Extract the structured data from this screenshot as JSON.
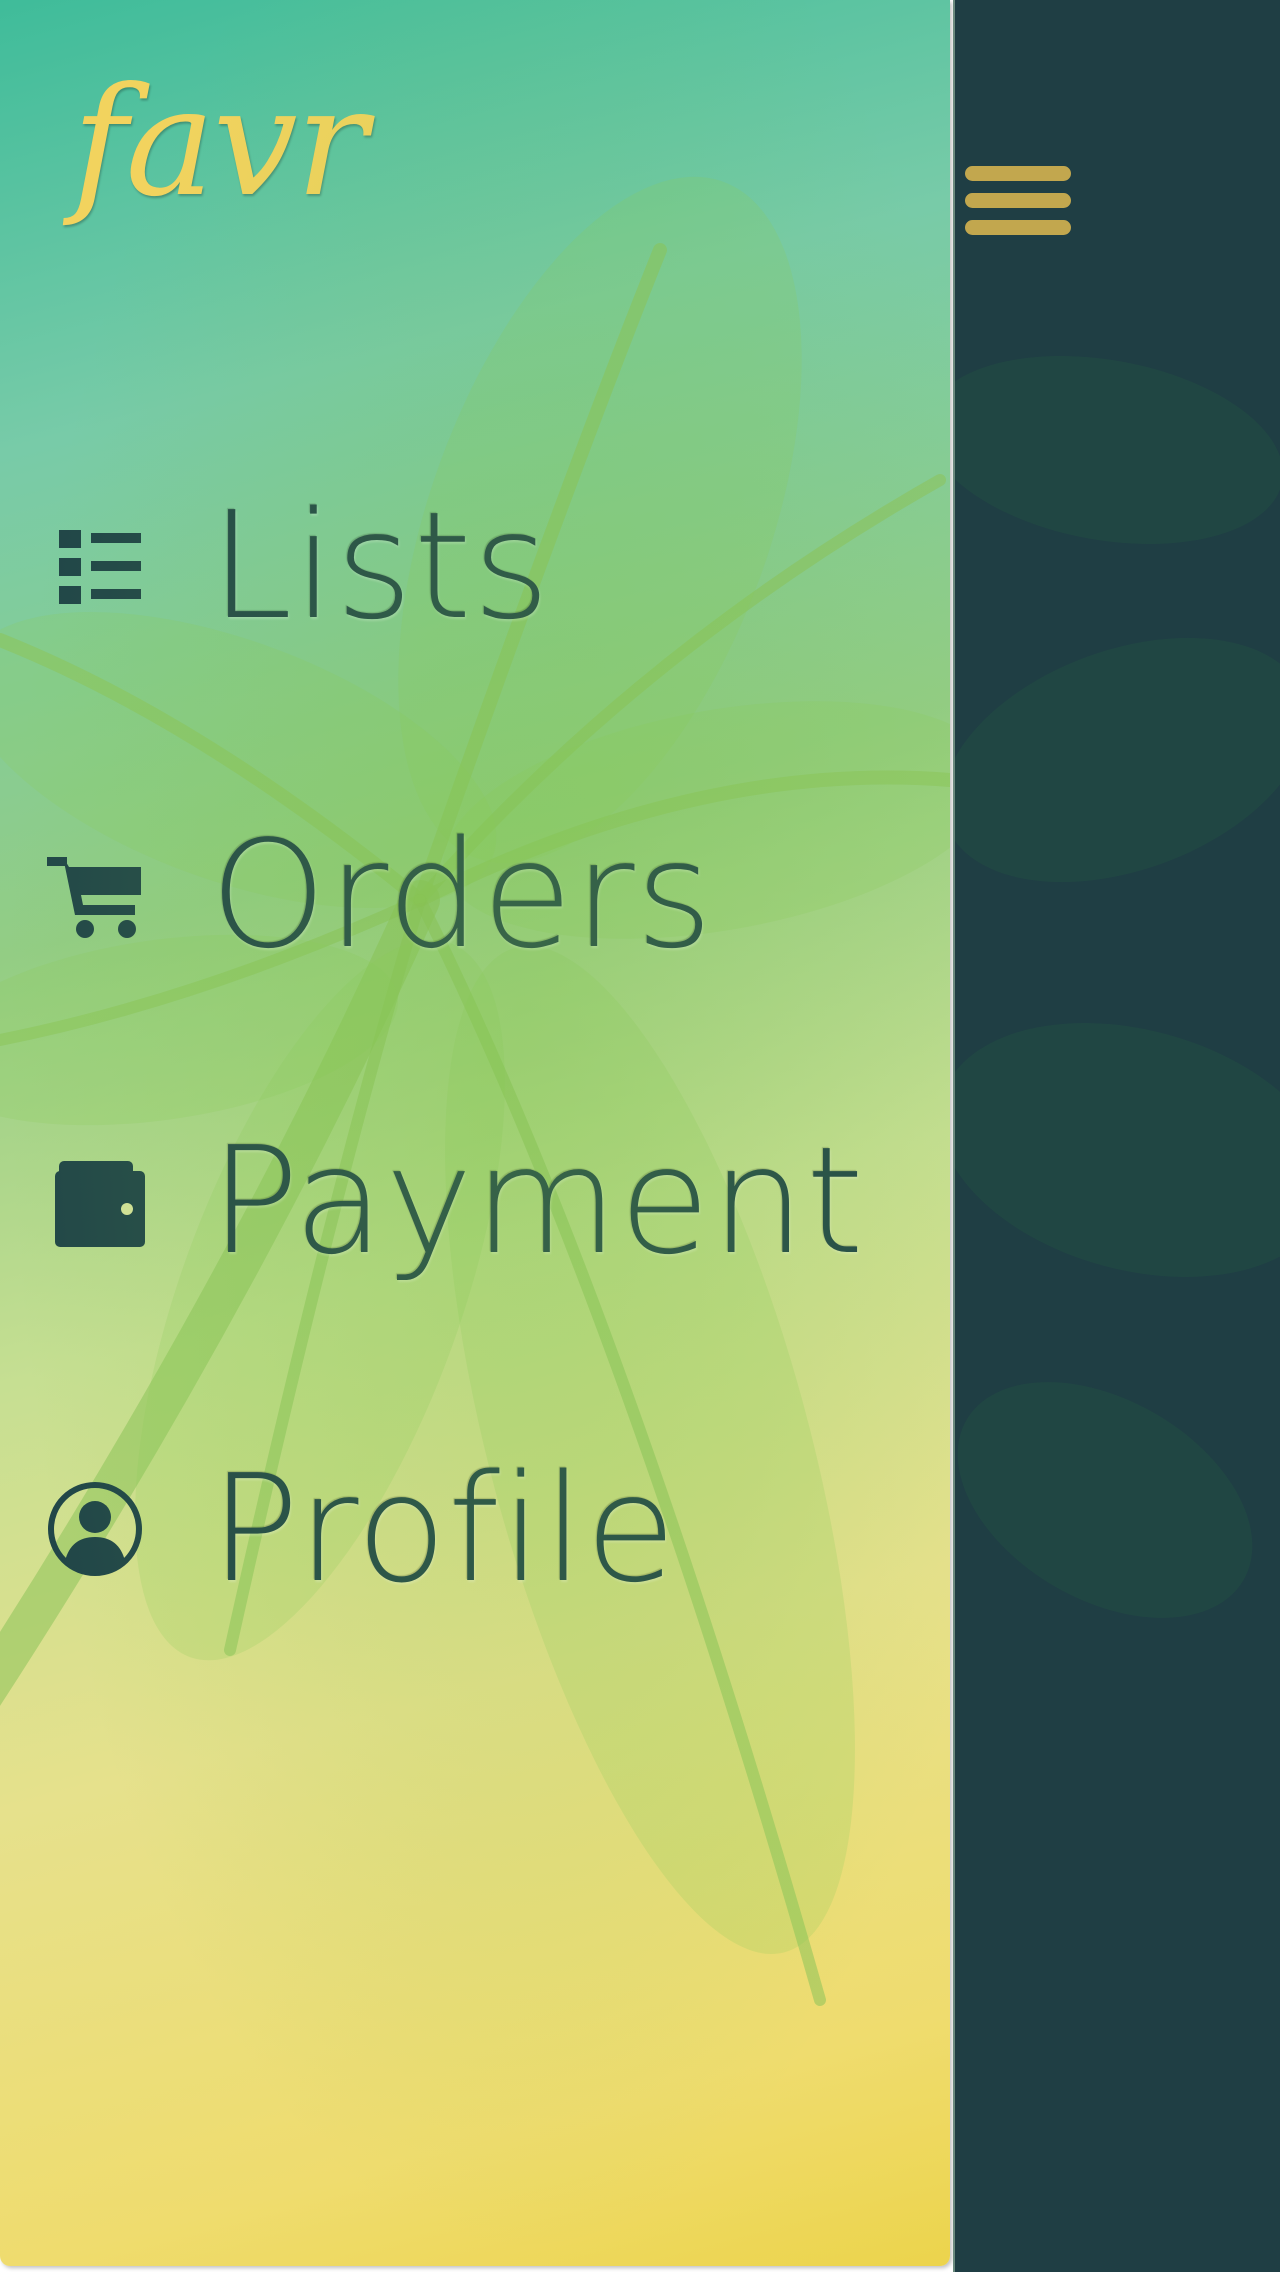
{
  "app": {
    "logo": "favr"
  },
  "menu": {
    "items": [
      {
        "id": "lists",
        "label": "Lists",
        "icon": "list-icon"
      },
      {
        "id": "orders",
        "label": "Orders",
        "icon": "cart-icon"
      },
      {
        "id": "payment",
        "label": "Payment",
        "icon": "wallet-icon"
      },
      {
        "id": "profile",
        "label": "Profile",
        "icon": "user-circle-icon"
      }
    ]
  },
  "header": {
    "menu_icon": "hamburger-icon"
  },
  "colors": {
    "text": "#214648",
    "logo": "#f2d35e",
    "strip": "#1f3e44",
    "hamburger": "#c2a74e",
    "gradient_top": "#3fbc9a",
    "gradient_bottom": "#ecd44c"
  }
}
